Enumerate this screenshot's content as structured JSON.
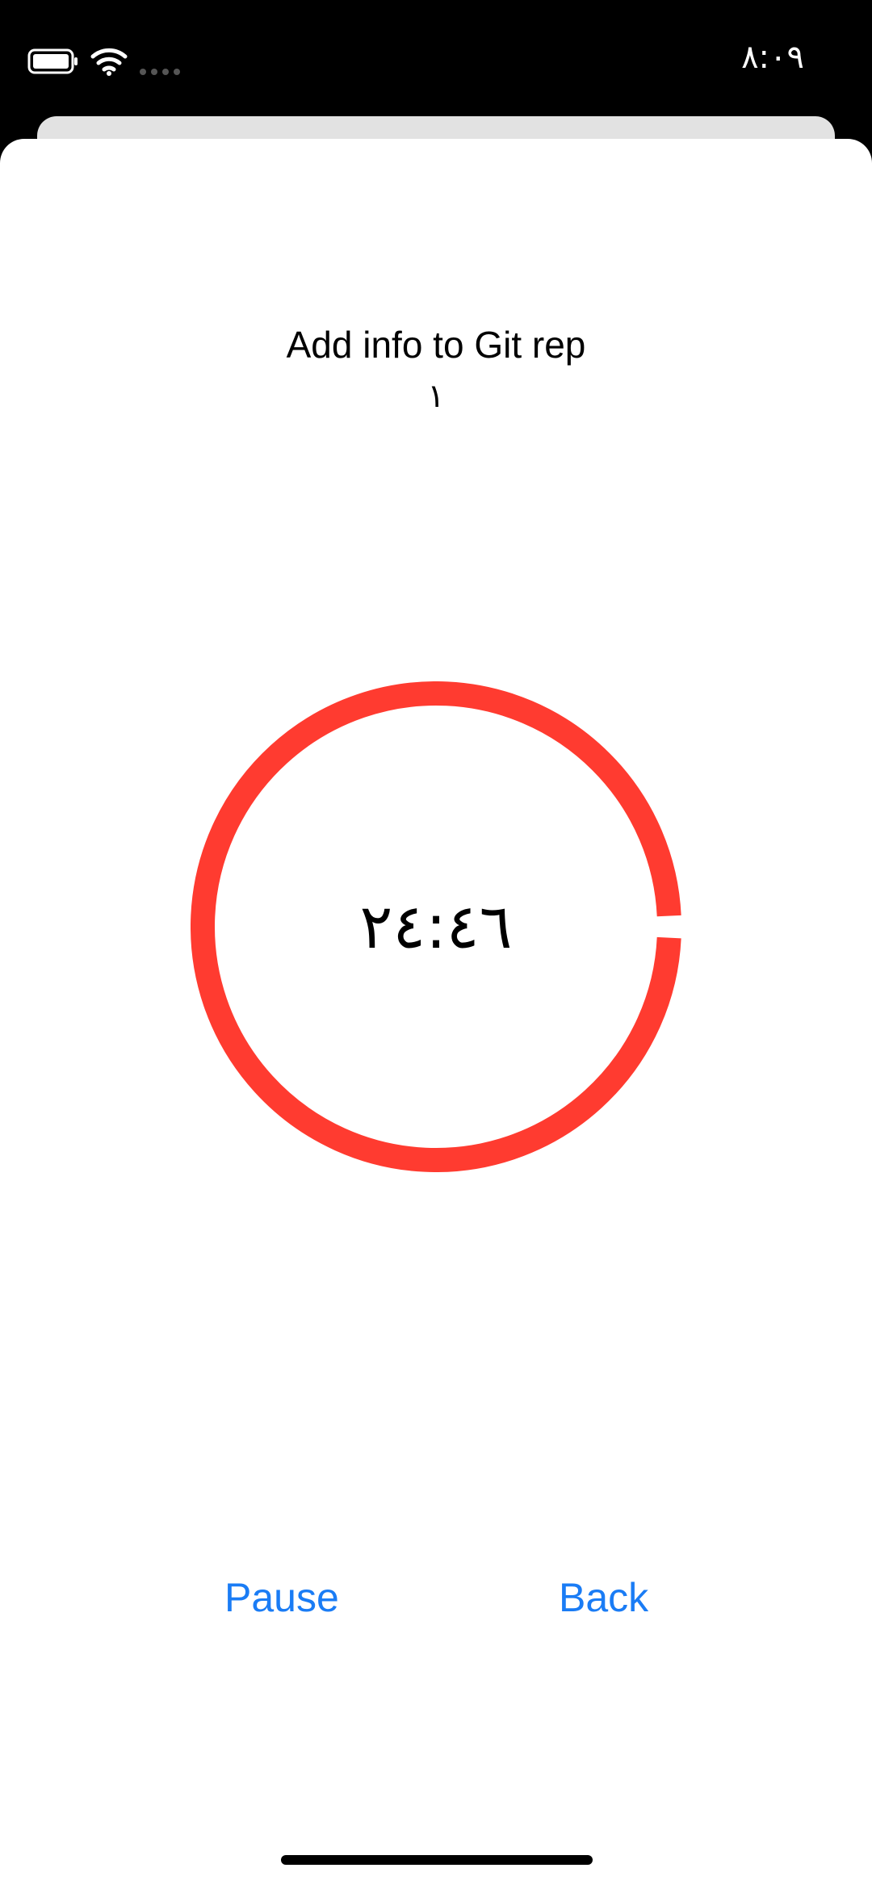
{
  "status_bar": {
    "time": "٨:٠٩",
    "battery_icon": "battery-icon",
    "wifi_icon": "wifi-icon",
    "signal_icon": "signal-dots-icon"
  },
  "task": {
    "title": "Add info to Git rep",
    "count": "١"
  },
  "timer": {
    "display": "٢٤:٤٦",
    "progress": 0.985,
    "ring_color": "#ff3b30"
  },
  "actions": {
    "pause_label": "Pause",
    "back_label": "Back",
    "accent_color": "#1a7cf5"
  }
}
